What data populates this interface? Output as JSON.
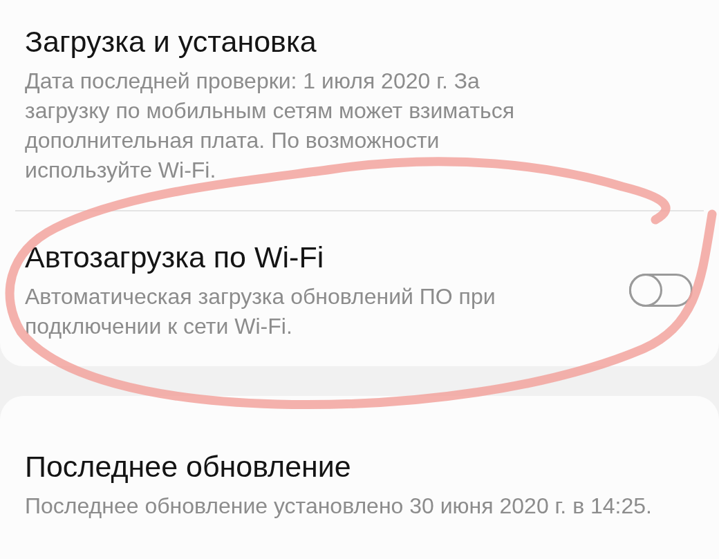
{
  "cards": [
    {
      "items": [
        {
          "kind": "text",
          "title": "Загрузка и установка",
          "subtitle": "Дата последней проверки: 1 июля 2020 г. За загрузку по мобильным сетям может взиматься дополнительная плата. По возможности используйте Wi-Fi."
        },
        {
          "kind": "switch",
          "title": "Автозагрузка по Wi-Fi",
          "subtitle": "Автоматическая загрузка обновлений ПО при подключении к сети Wi-Fi.",
          "on": false
        }
      ]
    },
    {
      "items": [
        {
          "kind": "text",
          "title": "Последнее обновление",
          "subtitle": "Последнее обновление установлено 30 июня 2020 г. в 14:25."
        }
      ]
    }
  ]
}
